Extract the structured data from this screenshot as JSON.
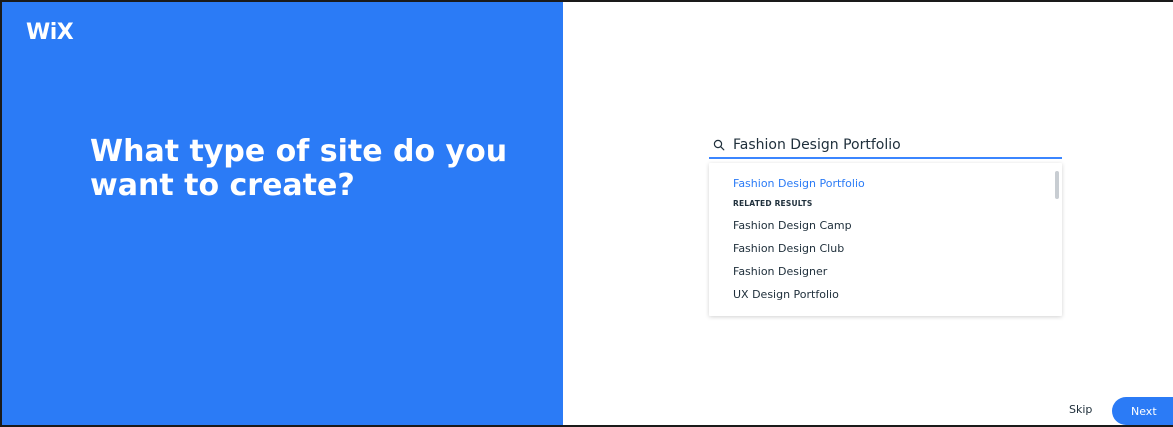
{
  "brand": {
    "logo_text": "WiX"
  },
  "headline": "What type of site do you want to create?",
  "search": {
    "value": "Fashion Design Portfolio",
    "icon": "search-icon"
  },
  "results": {
    "top_match": "Fashion Design Portfolio",
    "section_label": "RELATED RESULTS",
    "related": [
      "Fashion Design Camp",
      "Fashion Design Club",
      "Fashion Designer",
      "UX Design Portfolio"
    ]
  },
  "footer": {
    "skip_label": "Skip",
    "next_label": "Next"
  },
  "colors": {
    "accent": "#2b7bf6",
    "text": "#20303c"
  }
}
